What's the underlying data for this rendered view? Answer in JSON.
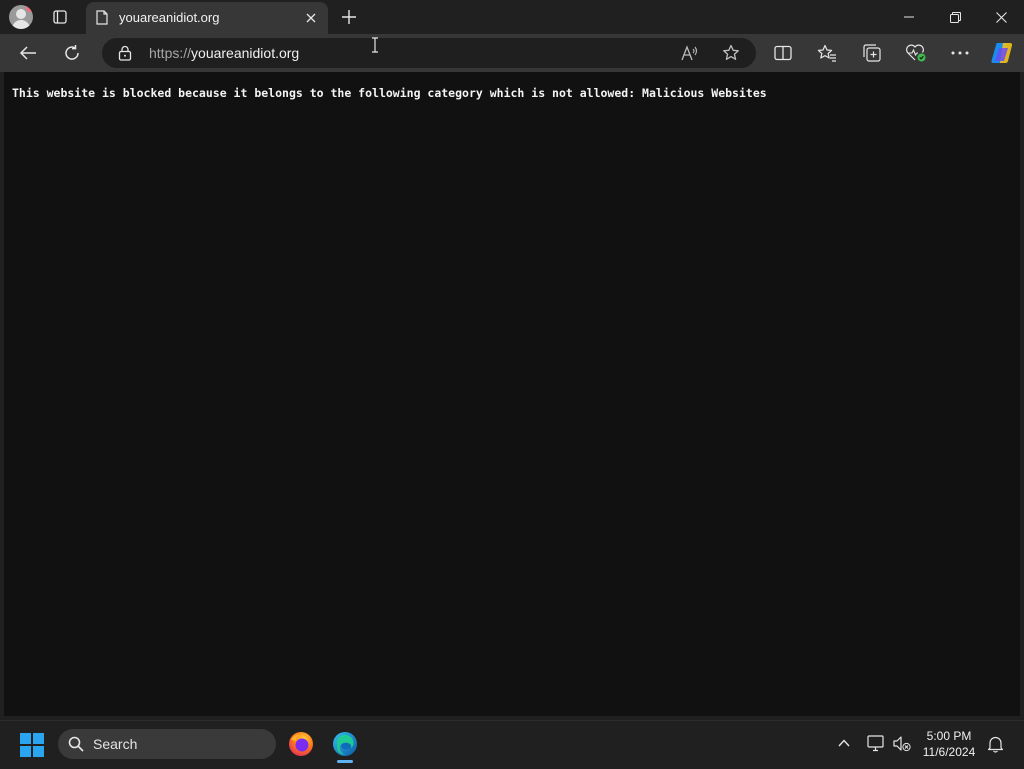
{
  "browser": {
    "tab": {
      "title": "youareanidiot.org"
    },
    "address": {
      "scheme": "https://",
      "host": "youareanidiot.org"
    }
  },
  "page": {
    "message": "This website is blocked because it belongs to the following category which is not allowed: Malicious Websites"
  },
  "taskbar": {
    "search_label": "Search",
    "time": "5:00 PM",
    "date": "11/6/2024"
  },
  "colors": {
    "chrome_bg": "#202020",
    "toolbar_bg": "#373737",
    "content_bg": "#111111",
    "windows_blue": "#2aa5f0"
  },
  "icons": [
    "profile-avatar-icon",
    "tab-actions-icon",
    "page-favicon-icon",
    "close-tab-icon",
    "new-tab-icon",
    "minimize-icon",
    "restore-icon",
    "close-window-icon",
    "back-icon",
    "refresh-icon",
    "lock-icon",
    "read-aloud-icon",
    "favorite-star-icon",
    "split-screen-icon",
    "favorites-icon",
    "collections-icon",
    "browser-essentials-icon",
    "more-icon",
    "copilot-icon",
    "windows-start-icon",
    "search-icon",
    "firefox-icon",
    "edge-icon",
    "chevron-up-icon",
    "network-icon",
    "volume-muted-icon",
    "notification-bell-icon"
  ]
}
